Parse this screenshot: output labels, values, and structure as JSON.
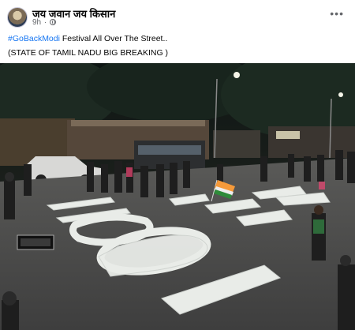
{
  "post": {
    "page_name": "जय जवान जय किसान",
    "time": "9h",
    "separator": "·",
    "privacy_icon": "globe-icon",
    "more_icon": "more-horizontal-icon",
    "more_label": "•••",
    "hashtag": "#GoBackModi",
    "line1_rest": " Festival All Over The Street..",
    "line2": "(STATE OF TAMIL NADU BIG BREAKING )"
  },
  "photo": {
    "road_text": [
      "GO BACK",
      "MODI"
    ]
  },
  "colors": {
    "link": "#1877f2",
    "text": "#050505",
    "muted": "#65676b"
  }
}
